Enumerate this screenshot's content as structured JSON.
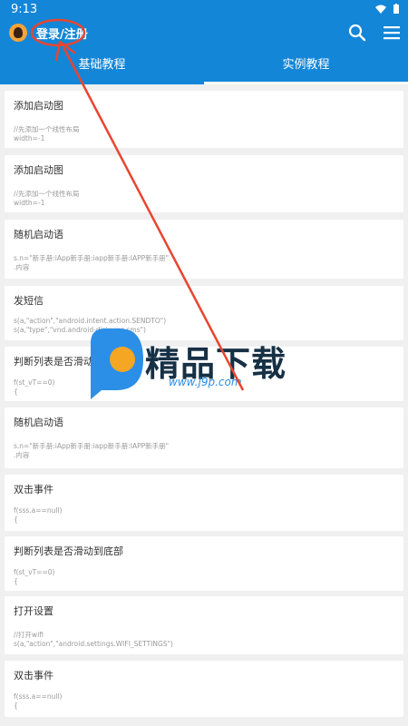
{
  "status": {
    "time": "9:13"
  },
  "toolbar": {
    "login_label": "登录/注册"
  },
  "tabs": [
    {
      "label": "基础教程",
      "active": false
    },
    {
      "label": "实例教程",
      "active": true
    }
  ],
  "cards": [
    {
      "title": "添加启动图",
      "body": "//先添加一个线性布局\nwidth=-1"
    },
    {
      "title": "添加启动图",
      "body": "//先添加一个线性布局\nwidth=-1"
    },
    {
      "title": "随机启动语",
      "body": "s.n=\"新手册:iApp新手册:iapp新手册:IAPP新手册\"\n.内容"
    },
    {
      "title": "发短信",
      "body": "s(a,\"action\",\"android.intent.action.SENDTO\")\ns(a,\"type\",\"vnd.android-dir/mms-sms\")"
    },
    {
      "title": "判断列表是否滑动到底部",
      "body": "f(st_vT==0)\n{"
    },
    {
      "title": "随机启动语",
      "body": "s.n=\"新手册:iApp新手册:iapp新手册:IAPP新手册\"\n.内容"
    },
    {
      "title": "双击事件",
      "body": "f(sss.a==null)\n{"
    },
    {
      "title": "判断列表是否滑动到底部",
      "body": "f(st_vT==0)\n{"
    },
    {
      "title": "打开设置",
      "body": "//打开wifi\ns(a,\"action\",\"android.settings.WIFI_SETTINGS\")"
    },
    {
      "title": "双击事件",
      "body": "f(sss.a==null)\n{"
    }
  ],
  "watermark": {
    "text": "精品下载",
    "url": "www.j9p.com"
  },
  "colors": {
    "appbar": "#1386d8",
    "annotation": "#e8452f"
  }
}
